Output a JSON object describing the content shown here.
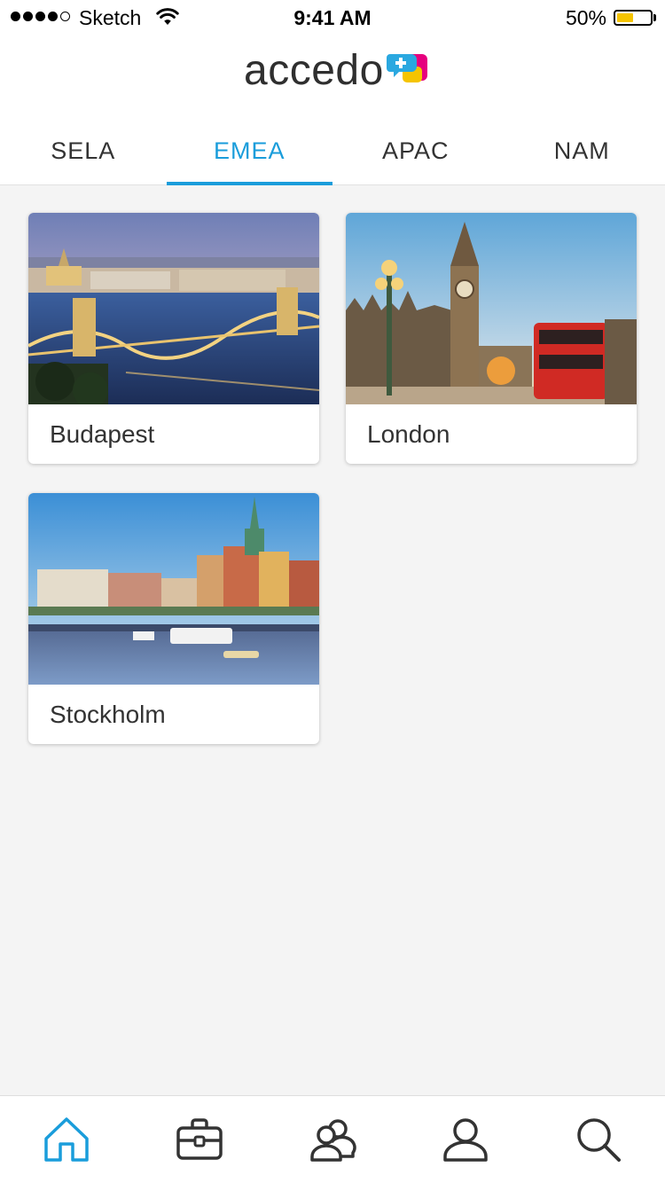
{
  "status_bar": {
    "carrier": "Sketch",
    "time": "9:41 AM",
    "battery": "50%",
    "battery_level": 0.5
  },
  "header": {
    "logo_text": "accedo",
    "logo_icon": "accedo-plus-logo-icon"
  },
  "tabs": [
    {
      "label": "SELA",
      "active": false
    },
    {
      "label": "EMEA",
      "active": true
    },
    {
      "label": "APAC",
      "active": false
    },
    {
      "label": "NAM",
      "active": false
    }
  ],
  "cities": [
    {
      "name": "Budapest",
      "image": "budapest-chain-bridge-photo"
    },
    {
      "name": "London",
      "image": "london-big-ben-photo"
    },
    {
      "name": "Stockholm",
      "image": "stockholm-gamla-stan-photo"
    }
  ],
  "bottom_nav": [
    {
      "icon": "home-icon",
      "active": true
    },
    {
      "icon": "briefcase-icon",
      "active": false
    },
    {
      "icon": "people-icon",
      "active": false
    },
    {
      "icon": "person-icon",
      "active": false
    },
    {
      "icon": "search-icon",
      "active": false
    }
  ],
  "colors": {
    "accent": "#1a9ddb",
    "background": "#f4f4f4",
    "battery": "#f5c400"
  }
}
